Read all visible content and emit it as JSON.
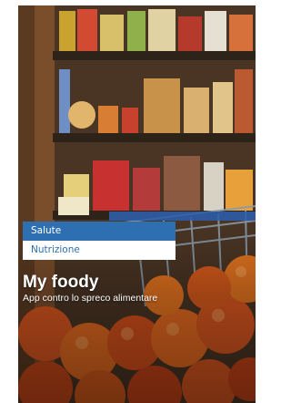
{
  "menu": {
    "items": [
      {
        "label": "Salute",
        "active": true
      },
      {
        "label": "Nutrizione",
        "active": false
      }
    ]
  },
  "hero": {
    "title": "My foody",
    "subtitle": "App contro lo spreco alimentare",
    "image_icon": "supermarket-shelf-photo"
  },
  "colors": {
    "accent": "#2d6fb1",
    "menu_text_inactive": "#2d6fb1",
    "menu_bg_inactive": "#ffffff",
    "title_text": "#ffffff"
  }
}
